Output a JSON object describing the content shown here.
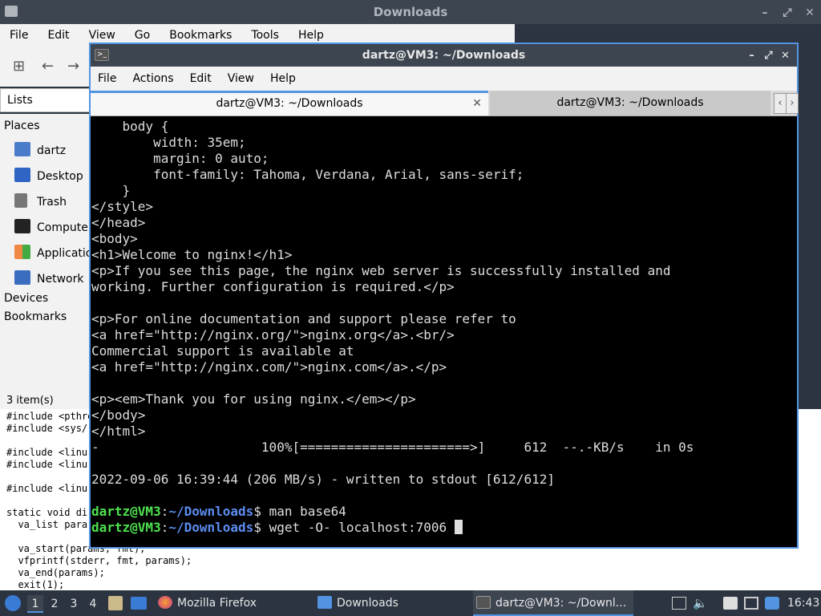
{
  "file_manager": {
    "title": "Downloads",
    "menu": [
      "File",
      "Edit",
      "View",
      "Go",
      "Bookmarks",
      "Tools",
      "Help"
    ],
    "lists_label": "Lists",
    "places_header": "Places",
    "places": [
      "dartz",
      "Desktop",
      "Trash",
      "Computer",
      "Applications",
      "Network"
    ],
    "devices_header": "Devices",
    "bookmarks_header": "Bookmarks",
    "status": "3 item(s)"
  },
  "code_editor_lines": [
    "#include <pthread.h>",
    "#include <sys/",
    "",
    "#include <linu",
    "#include <linu",
    "",
    "#include <linu",
    "",
    "static void di",
    "  va_list para",
    "",
    "  va_start(params, fmt);",
    "  vfprintf(stderr, fmt, params);",
    "  va_end(params);",
    "  exit(1);"
  ],
  "terminal": {
    "title": "dartz@VM3: ~/Downloads",
    "menu": [
      "File",
      "Actions",
      "Edit",
      "View",
      "Help"
    ],
    "tabs": [
      "dartz@VM3: ~/Downloads",
      "dartz@VM3: ~/Downloads"
    ],
    "output_lines": [
      "    body {",
      "        width: 35em;",
      "        margin: 0 auto;",
      "        font-family: Tahoma, Verdana, Arial, sans-serif;",
      "    }",
      "</style>",
      "</head>",
      "<body>",
      "<h1>Welcome to nginx!</h1>",
      "<p>If you see this page, the nginx web server is successfully installed and",
      "working. Further configuration is required.</p>",
      "",
      "<p>For online documentation and support please refer to",
      "<a href=\"http://nginx.org/\">nginx.org</a>.<br/>",
      "Commercial support is available at",
      "<a href=\"http://nginx.com/\">nginx.com</a>.</p>",
      "",
      "<p><em>Thank you for using nginx.</em></p>",
      "</body>",
      "</html>",
      "-                     100%[======================>]     612  --.-KB/s    in 0s",
      "",
      "2022-09-06 16:39:44 (206 MB/s) - written to stdout [612/612]",
      ""
    ],
    "prompt_user": "dartz@VM3",
    "prompt_sep": ":",
    "prompt_path": "~/Downloads",
    "prompt_dollar": "$",
    "commands": [
      " man base64",
      " wget -O- localhost:7006 "
    ]
  },
  "taskbar": {
    "workspaces": [
      "1",
      "2",
      "3",
      "4"
    ],
    "tasks": [
      "Mozilla Firefox",
      "Downloads",
      "dartz@VM3: ~/Downl..."
    ],
    "clock": "16:43"
  },
  "colors": {
    "accent": "#5294e2",
    "prompt_green": "#4ee24e",
    "prompt_blue": "#5c8cf0"
  }
}
